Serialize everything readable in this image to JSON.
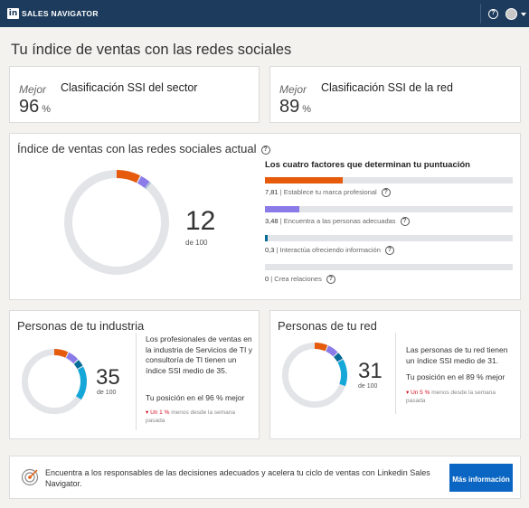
{
  "header": {
    "logo_mark": "in",
    "app_name": "SALES NAVIGATOR",
    "help_icon": "?"
  },
  "page_title": "Tu índice de ventas con las redes sociales",
  "sector_rank": {
    "prefix": "Mejor",
    "title": "Clasificación SSI del sector",
    "value": "96",
    "unit": "%"
  },
  "network_rank": {
    "prefix": "Mejor",
    "title": "Clasificación SSI de la red",
    "value": "89",
    "unit": "%"
  },
  "current_ssi": {
    "title": "Índice de ventas con las redes sociales actual",
    "score": "12",
    "score_suffix": "de 100",
    "factors_title": "Los cuatro factores que determinan tu puntuación",
    "factors": [
      {
        "value": "7,81",
        "label": "Establece tu marca profesional",
        "max": 25,
        "color": "#e55a0b"
      },
      {
        "value": "3,48",
        "label": "Encuentra a las personas adecuadas",
        "max": 25,
        "color": "#8b7be8"
      },
      {
        "value": "0,3",
        "label": "Interactúa ofreciendo información",
        "max": 25,
        "color": "#056c99"
      },
      {
        "value": "0",
        "label": "Crea relaciones",
        "max": 25,
        "color": "#14a7d8"
      }
    ]
  },
  "industry": {
    "title": "Personas de tu industria",
    "score": "35",
    "score_suffix": "de 100",
    "description": "Los profesionales de ventas en la industria de Servicios de TI y consultoría de TI tienen un índice SSI medio de 35.",
    "position": "Tu posición en el 96 % mejor",
    "delta_marker": "▾ Un 1 %",
    "delta_text": "menos desde la semana pasada",
    "segments": [
      7.5,
      6,
      4,
      17.5
    ]
  },
  "network": {
    "title": "Personas de tu red",
    "score": "31",
    "score_suffix": "de 100",
    "description": "Las personas de tu red tienen un índice SSI medio de 31.",
    "position": "Tu posición en el 89 % mejor",
    "delta_marker": "▾ Un 5 %",
    "delta_text": "menos desde la semana pasada",
    "segments": [
      7,
      6,
      4,
      14
    ]
  },
  "cta": {
    "text": "Encuentra a los responsables de las decisiones adecuados y acelera tu ciclo de ventas con Linkedin Sales Navigator.",
    "button": "Más información"
  },
  "colors": {
    "orange": "#e55a0b",
    "purple": "#8b7be8",
    "teal": "#056c99",
    "blue": "#14a7d8",
    "track": "#e2e4e8",
    "brand": "#1d3b5c",
    "button": "#0a66c2"
  }
}
